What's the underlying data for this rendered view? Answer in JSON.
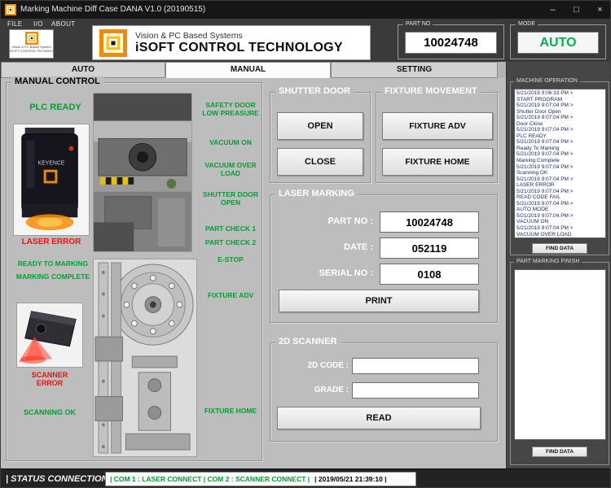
{
  "window": {
    "title": "Marking Machine Diff Case DANA V1.0 (20190515)",
    "menus": [
      "FILE",
      "I/O",
      "ABOUT"
    ],
    "controls": {
      "minimize": "–",
      "maximize": "□",
      "close": "×"
    }
  },
  "header": {
    "brand": {
      "line1": "Vision & PC Based Systems",
      "line2": "iSOFT CONTROL TECHNOLOGY",
      "caption1": "Vision & PC Based System",
      "caption2": "iSOFT CONTROL TECHNOLOGY"
    },
    "part_no": {
      "label": "PART NO",
      "value": "10024748"
    },
    "mode": {
      "label": "MODE",
      "value": "AUTO"
    }
  },
  "tabs": [
    {
      "label": "AUTO"
    },
    {
      "label": "MANUAL"
    },
    {
      "label": "SETTING"
    }
  ],
  "manual": {
    "group_title": "MANUAL CONTROL",
    "device_brand": "KEYENCE",
    "statuses": {
      "plc_ready": "PLC READY",
      "laser_error": "LASER ERROR",
      "ready_to_marking": "READY TO MARKING",
      "marking_complete": "MARKING COMPLETE",
      "scanner_error": "SCANNER ERROR",
      "scanning_ok": "SCANNING OK"
    },
    "io_labels": [
      "SAFETY DOOR LOW PREASURE",
      "VACUUM ON",
      "VACUUM OVER LOAD",
      "SHUTTER DOOR OPEN",
      "PART CHECK 1",
      "PART CHECK 2",
      "E-STOP",
      "FIXTURE ADV",
      "FIXTURE HOME"
    ]
  },
  "shutter_door": {
    "title": "SHUTTER DOOR",
    "open": "OPEN",
    "close": "CLOSE"
  },
  "fixture_movement": {
    "title": "FIXTURE MOVEMENT",
    "adv": "FIXTURE ADV",
    "home": "FIXTURE HOME"
  },
  "laser_marking": {
    "title": "LASER MARKING",
    "part_no_label": "PART NO :",
    "part_no_value": "10024748",
    "date_label": "DATE :",
    "date_value": "052119",
    "serial_label": "SERIAL NO :",
    "serial_value": "0108",
    "print": "PRINT"
  },
  "scanner_2d": {
    "title": "2D SCANNER",
    "code_label": "2D CODE :",
    "code_value": "",
    "grade_label": "GRADE :",
    "grade_value": "",
    "read": "READ"
  },
  "sidebar": {
    "machine_operation": {
      "title": "MACHINE OPERATION",
      "find_button": "FIND DATA",
      "log": [
        "5/21/2019 9:06:33 PM >",
        "START PROGRAM",
        "5/21/2019 9:07:04 PM >",
        "Shutter Door Open",
        "5/21/2019 9:07:04 PM >",
        "Door Close",
        "5/21/2019 9:07:04 PM >",
        "PLC READY",
        "5/21/2019 9:07:04 PM >",
        "Ready To Marking",
        "5/21/2019 9:07:04 PM >",
        "Marking Complete",
        "5/21/2019 9:07:04 PM >",
        "Scanning OK",
        "5/21/2019 9:07:04 PM >",
        "LASER ERROR",
        "5/21/2019 9:07:04 PM >",
        "READ CODE FAIL",
        "5/21/2019 9:07:04 PM >",
        "AUTO MODE",
        "5/21/2019 9:07:04 PM >",
        "VACUUM ON",
        "5/21/2019 9:07:04 PM >",
        "VACUUM OVER LOAD"
      ]
    },
    "part_marking_finish": {
      "title": "PART MARKING FINISH",
      "find_button": "FIND DATA"
    }
  },
  "status_bar": {
    "left": "| STATUS CONNECTION |",
    "com": "| COM 1 : LASER CONNECT | COM 2  : SCANNER CONNECT |",
    "datetime": "| 2019/05/21 21:39:10 |"
  },
  "colors": {
    "green": "#00a033",
    "red": "#ee1111",
    "mode_green": "#00b050",
    "log_text": "#1b2a7e",
    "orange": "#f08a00"
  }
}
